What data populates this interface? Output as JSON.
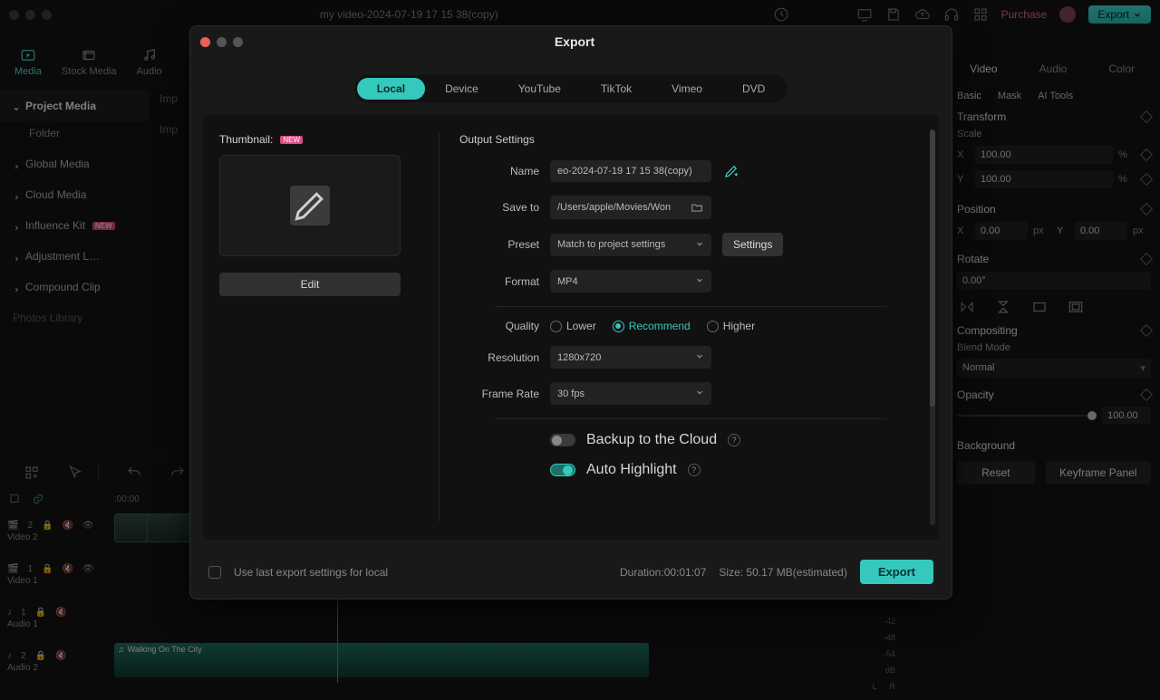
{
  "window": {
    "title": "my video-2024-07-19 17 15 38(copy)",
    "purchase": "Purchase",
    "export": "Export"
  },
  "tool_tabs": [
    "Media",
    "Stock Media",
    "Audio"
  ],
  "inspector_tabs": [
    "Video",
    "Audio",
    "Color"
  ],
  "sub_tabs": [
    "Basic",
    "Mask",
    "AI Tools"
  ],
  "sidebar": {
    "project": "Project Media",
    "folder": "Folder",
    "global": "Global Media",
    "cloud": "Cloud Media",
    "influence": "Influence Kit",
    "adjust": "Adjustment L…",
    "compound": "Compound Clip",
    "photos": "Photos Library",
    "new_badge": "NEW"
  },
  "mediapane": {
    "imp1": "Imp",
    "imp2": "Imp"
  },
  "inspector": {
    "transform": "Transform",
    "scale": "Scale",
    "scale_x": "100.00",
    "scale_y": "100.00",
    "position": "Position",
    "pos_x": "0.00",
    "pos_y": "0.00",
    "rotate": "Rotate",
    "rotate_v": "0.00°",
    "compositing": "Compositing",
    "blend": "Blend Mode",
    "blend_v": "Normal",
    "opacity": "Opacity",
    "opacity_v": "100.00",
    "background": "Background",
    "reset": "Reset",
    "keyframe": "Keyframe Panel",
    "pct": "%",
    "px": "px",
    "x": "X",
    "y": "Y"
  },
  "timeline": {
    "ruler_start": ":00:00",
    "video2": "Video 2",
    "video1": "Video 1",
    "audio1": "Audio 1",
    "audio2": "Audio 2",
    "v2_badge": "2",
    "v1_badge": "1",
    "a1_badge": "1",
    "a2_badge": "2",
    "clip_audio": "Walking On The City",
    "meters": {
      "m42": "-42",
      "m48": "-48",
      "m54": "-54",
      "dB": "dB",
      "L": "L",
      "R": "R"
    }
  },
  "modal": {
    "title": "Export",
    "tabs": [
      "Local",
      "Device",
      "YouTube",
      "TikTok",
      "Vimeo",
      "DVD"
    ],
    "thumbnail": "Thumbnail:",
    "new_badge": "NEW",
    "edit_btn": "Edit",
    "output_heading": "Output Settings",
    "labels": {
      "name": "Name",
      "saveto": "Save to",
      "preset": "Preset",
      "format": "Format",
      "quality": "Quality",
      "resolution": "Resolution",
      "framerate": "Frame Rate"
    },
    "values": {
      "name": "eo-2024-07-19 17 15 38(copy)",
      "saveto": "/Users/apple/Movies/Won",
      "preset": "Match to project settings",
      "format": "MP4",
      "resolution": "1280x720",
      "framerate": "30 fps"
    },
    "settings_btn": "Settings",
    "quality_opts": {
      "lower": "Lower",
      "rec": "Recommend",
      "higher": "Higher"
    },
    "backup": "Backup to the Cloud",
    "auto_highlight": "Auto Highlight",
    "use_last": "Use last export settings for local",
    "duration_lbl": "Duration:",
    "duration": "00:01:07",
    "size_lbl": "Size: ",
    "size": "50.17 MB",
    "est": "(estimated)",
    "export_btn": "Export"
  }
}
